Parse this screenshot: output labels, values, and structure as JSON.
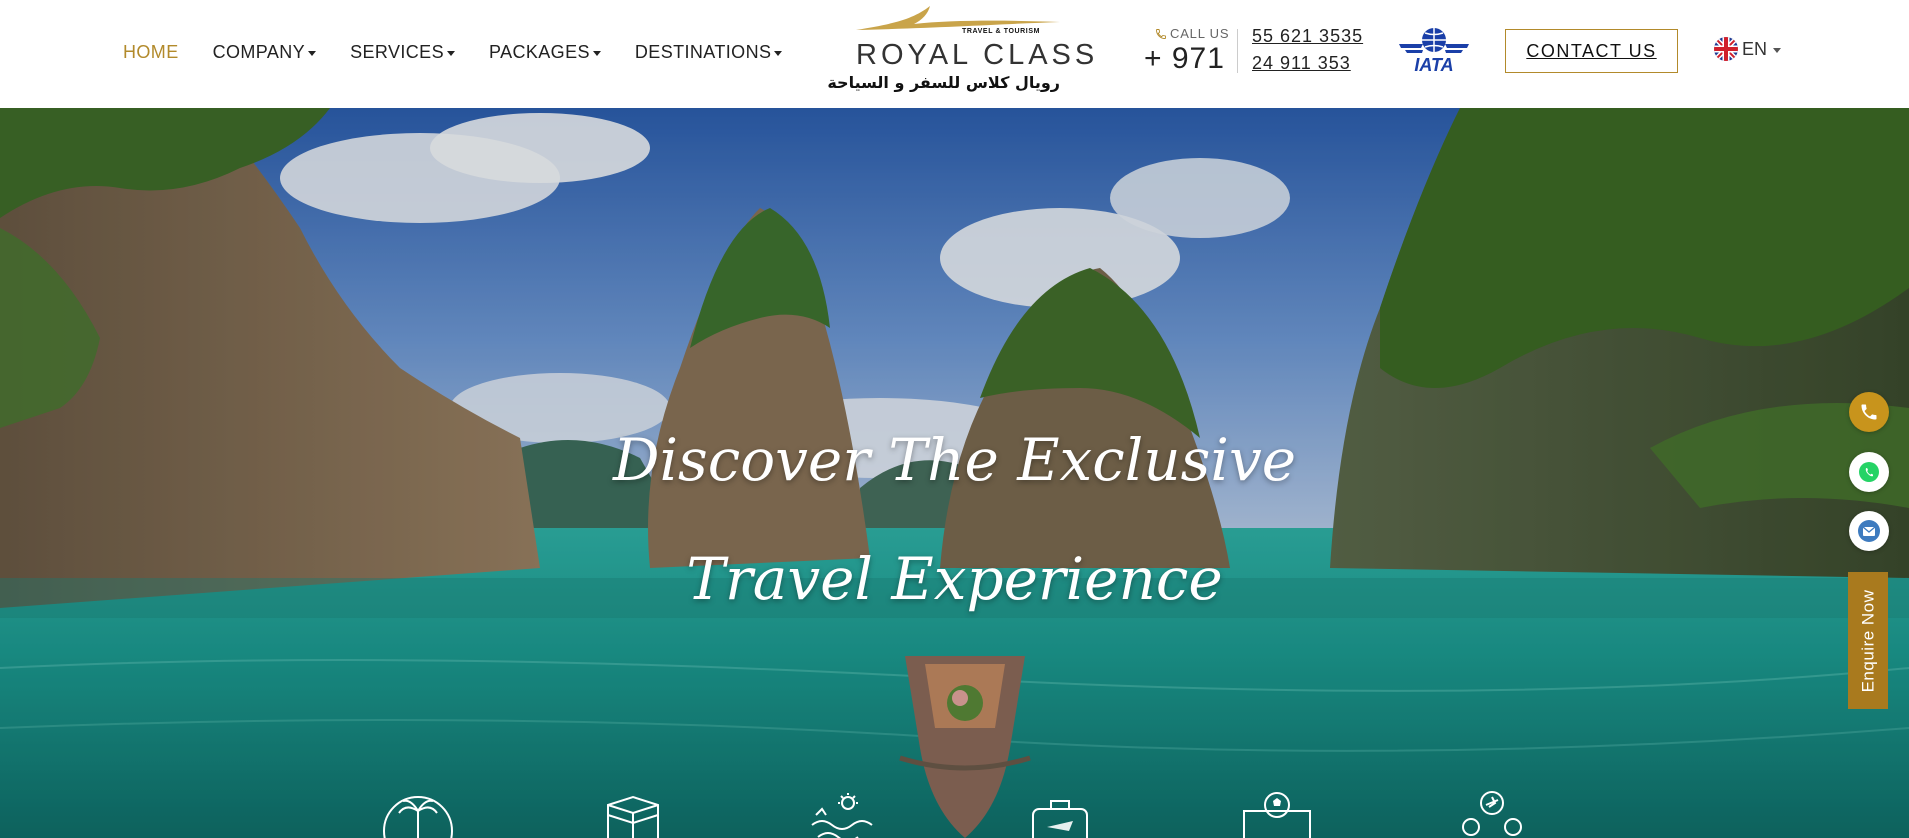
{
  "nav": {
    "items": [
      {
        "label": "HOME",
        "active": true,
        "dropdown": false
      },
      {
        "label": "COMPANY",
        "active": false,
        "dropdown": true
      },
      {
        "label": "SERVICES",
        "active": false,
        "dropdown": true
      },
      {
        "label": "PACKAGES",
        "active": false,
        "dropdown": true
      },
      {
        "label": "DESTINATIONS",
        "active": false,
        "dropdown": true
      }
    ]
  },
  "logo": {
    "tagline": "TRAVEL & TOURISM",
    "name": "ROYAL CLASS",
    "arabic": "رويال كلاس للسفر و السياحة"
  },
  "contact": {
    "call_label": "CALL US",
    "country_code": "+ 971",
    "phone_1": "55 621 3535",
    "phone_2": "24 911 353",
    "iata_label": "IATA",
    "button_label": "CONTACT US"
  },
  "language": {
    "code": "EN",
    "flag_icon": "uk-flag-icon"
  },
  "hero": {
    "title_line_1": "Discover The Exclusive",
    "title_line_2": "Travel Experience"
  },
  "category_icons": [
    "palm-tree-icon",
    "kaaba-icon",
    "sun-sea-icon",
    "suitcase-icon",
    "football-ticket-icon",
    "plane-people-icon"
  ],
  "floating": {
    "call_icon": "phone-icon",
    "whatsapp_icon": "whatsapp-icon",
    "email_icon": "email-icon",
    "enquire_label": "Enquire Now"
  },
  "colors": {
    "accent_gold": "#b28a2b",
    "call_button": "#c8941c",
    "enquire_button": "#a97a1e",
    "whatsapp_green": "#25d366",
    "email_blue": "#3e7bbf",
    "iata_blue": "#1a3fa8"
  }
}
